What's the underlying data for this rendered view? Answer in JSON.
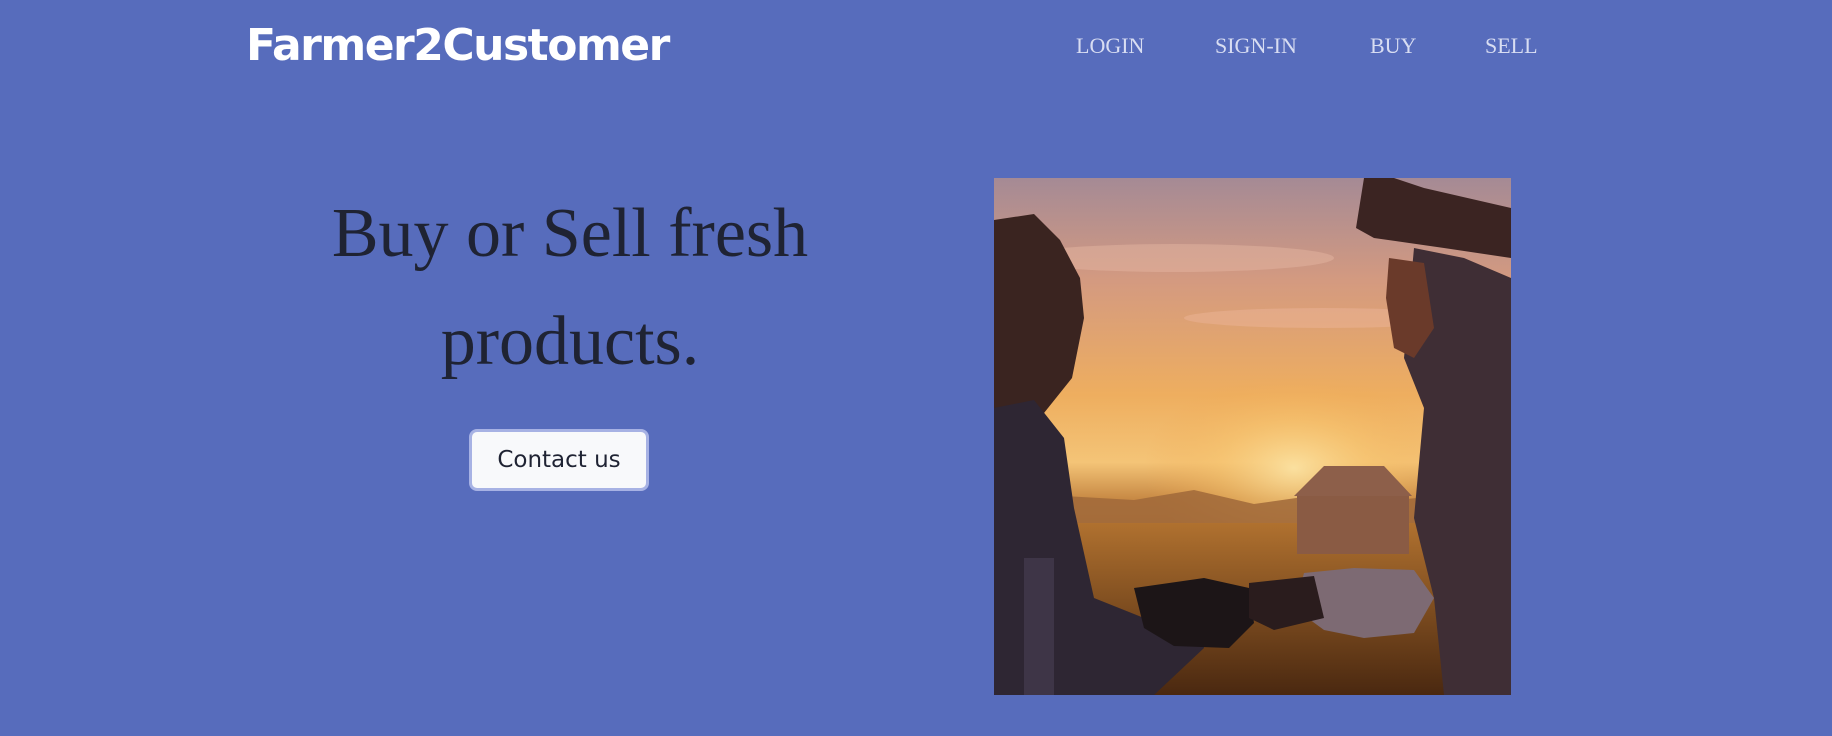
{
  "brand": {
    "name": "Farmer2Customer"
  },
  "nav": {
    "items": [
      {
        "label": "LOGIN"
      },
      {
        "label": "SIGN-IN"
      },
      {
        "label": "BUY"
      },
      {
        "label": "SELL"
      }
    ]
  },
  "hero": {
    "heading": "Buy or Sell fresh products.",
    "cta_label": "Contact us"
  },
  "colors": {
    "background": "#576cbc",
    "brand_text": "#ffffff",
    "nav_text": "#d8ddf2",
    "heading_text": "#1f2333",
    "button_bg": "#f8f9fb",
    "button_border": "#a7b2e4"
  }
}
